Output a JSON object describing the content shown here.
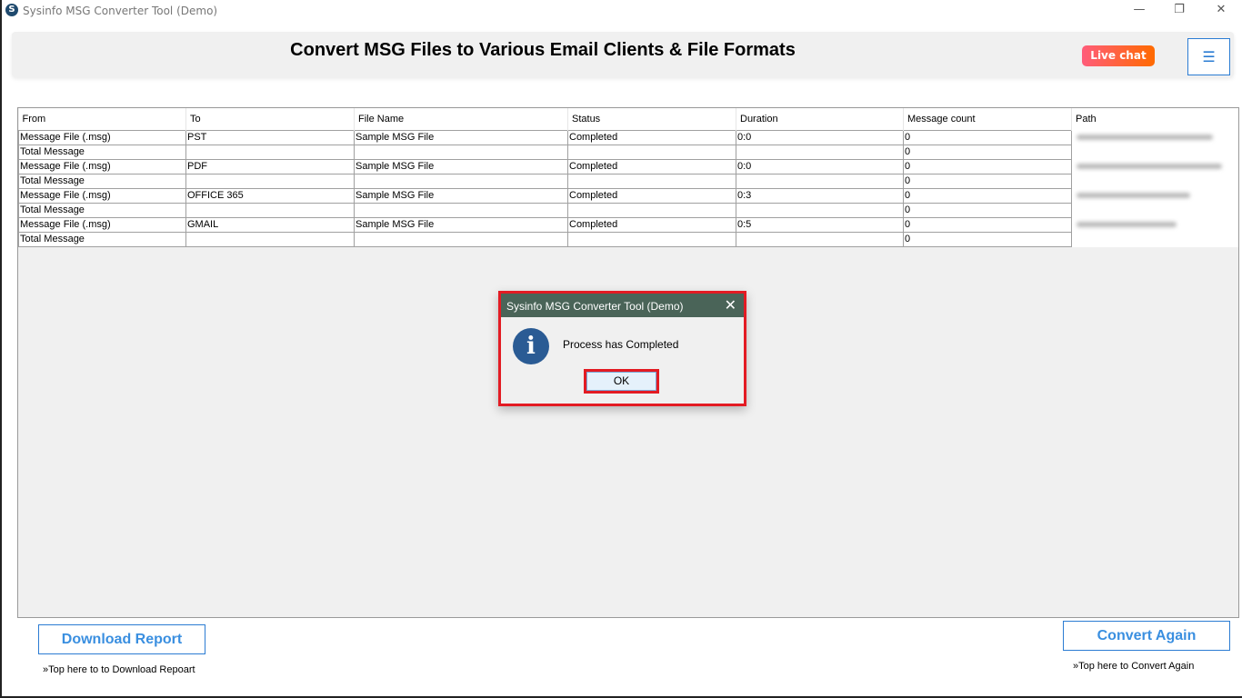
{
  "window": {
    "title": "Sysinfo MSG Converter Tool (Demo)",
    "minimize": "—",
    "restore": "❐",
    "close": "✕"
  },
  "header": {
    "title": "Convert MSG Files to Various Email Clients & File Formats",
    "live_chat": "Live chat",
    "menu_icon": "☰"
  },
  "table": {
    "columns": [
      "From",
      "To",
      "File Name",
      "Status",
      "Duration",
      "Message count",
      "Path"
    ],
    "rows": [
      [
        "Message File (.msg)",
        "PST",
        "Sample MSG File",
        "Completed",
        "0:0",
        "0"
      ],
      [
        "Total Message",
        "",
        "",
        "",
        "",
        "0"
      ],
      [
        "Message File (.msg)",
        "PDF",
        "Sample MSG File",
        "Completed",
        "0:0",
        "0"
      ],
      [
        "Total Message",
        "",
        "",
        "",
        "",
        "0"
      ],
      [
        "Message File (.msg)",
        "OFFICE 365",
        "Sample MSG File",
        "Completed",
        "0:3",
        "0"
      ],
      [
        "Total Message",
        "",
        "",
        "",
        "",
        "0"
      ],
      [
        "Message File (.msg)",
        "GMAIL",
        "Sample MSG File",
        "Completed",
        "0:5",
        "0"
      ],
      [
        "Total Message",
        "",
        "",
        "",
        "",
        "0"
      ]
    ]
  },
  "dialog": {
    "title": "Sysinfo MSG Converter Tool (Demo)",
    "message": "Process has Completed",
    "ok": "OK",
    "close": "✕",
    "icon": "i"
  },
  "footer": {
    "download": "Download Report",
    "download_hint": "»Top here to to Download Repoart",
    "convert": "Convert Again",
    "convert_hint": "»Top here to Convert Again"
  },
  "colors": {
    "accent": "#2b7cd3",
    "highlight": "#e31b23",
    "dialog_title": "#4a6458"
  }
}
